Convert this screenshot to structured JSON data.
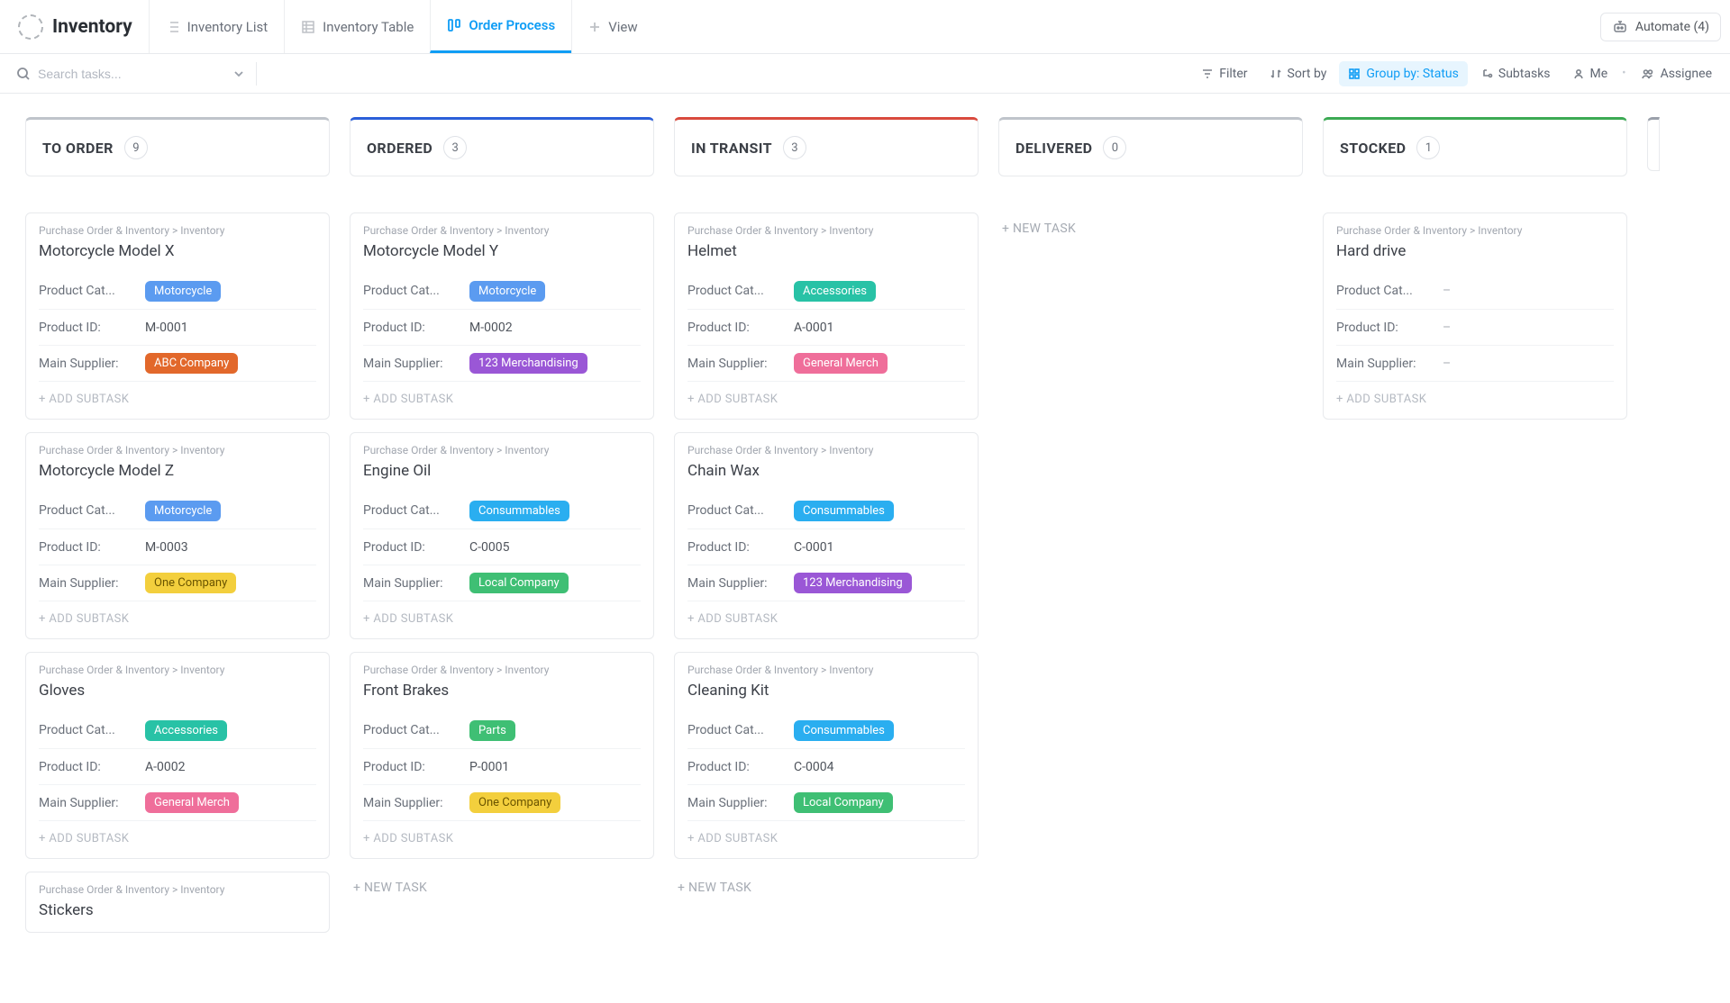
{
  "header": {
    "page_title": "Inventory",
    "tabs": [
      {
        "label": "Inventory List"
      },
      {
        "label": "Inventory Table"
      },
      {
        "label": "Order Process",
        "active": true
      },
      {
        "label": "View",
        "is_add": true
      }
    ],
    "automate_label": "Automate (4)"
  },
  "toolbar": {
    "search_placeholder": "Search tasks...",
    "filter": "Filter",
    "sort": "Sort by",
    "group": "Group by: Status",
    "subtasks": "Subtasks",
    "me": "Me",
    "assignee": "Assignee"
  },
  "labels": {
    "breadcrumb": "Purchase Order & Inventory  >  Inventory",
    "product_cat": "Product Cat...",
    "product_id": "Product ID:",
    "main_supplier": "Main Supplier:",
    "add_subtask": "+ ADD SUBTASK",
    "new_task": "+ NEW TASK",
    "empty": "–"
  },
  "colors": {
    "Motorcycle": "#5b9bf0",
    "Accessories": "#28c2a6",
    "Consummables": "#2aaef0",
    "Parts": "#3fbf74",
    "ABC Company": "#e2682b",
    "123 Merchandising": "#9a57d6",
    "General Merch": "#ef6e9a",
    "One Company": "#f3cf3d",
    "Local Company": "#3fbf74"
  },
  "columns": [
    {
      "key": "to_order",
      "title": "TO ORDER",
      "count": 9,
      "accent": "#bfc4cb",
      "cards": [
        {
          "title": "Motorcycle Model X",
          "category": "Motorcycle",
          "product_id": "M-0001",
          "supplier": "ABC Company"
        },
        {
          "title": "Motorcycle Model Z",
          "category": "Motorcycle",
          "product_id": "M-0003",
          "supplier": "One Company"
        },
        {
          "title": "Gloves",
          "category": "Accessories",
          "product_id": "A-0002",
          "supplier": "General Merch"
        },
        {
          "title": "Stickers",
          "partial": true
        }
      ]
    },
    {
      "key": "ordered",
      "title": "ORDERED",
      "count": 3,
      "accent": "#2b5fd9",
      "cards": [
        {
          "title": "Motorcycle Model Y",
          "category": "Motorcycle",
          "product_id": "M-0002",
          "supplier": "123 Merchandising"
        },
        {
          "title": "Engine Oil",
          "category": "Consummables",
          "product_id": "C-0005",
          "supplier": "Local Company"
        },
        {
          "title": "Front Brakes",
          "category": "Parts",
          "product_id": "P-0001",
          "supplier": "One Company"
        }
      ],
      "show_new_task": true
    },
    {
      "key": "in_transit",
      "title": "IN TRANSIT",
      "count": 3,
      "accent": "#d94a3d",
      "cards": [
        {
          "title": "Helmet",
          "category": "Accessories",
          "product_id": "A-0001",
          "supplier": "General Merch"
        },
        {
          "title": "Chain Wax",
          "category": "Consummables",
          "product_id": "C-0001",
          "supplier": "123 Merchandising"
        },
        {
          "title": "Cleaning Kit",
          "category": "Consummables",
          "product_id": "C-0004",
          "supplier": "Local Company"
        }
      ],
      "show_new_task": true
    },
    {
      "key": "delivered",
      "title": "DELIVERED",
      "count": 0,
      "accent": "#bfc4cb",
      "cards": [],
      "show_new_task": true
    },
    {
      "key": "stocked",
      "title": "STOCKED",
      "count": 1,
      "accent": "#3caa54",
      "cards": [
        {
          "title": "Hard drive",
          "category": null,
          "product_id": null,
          "supplier": null
        }
      ]
    }
  ]
}
